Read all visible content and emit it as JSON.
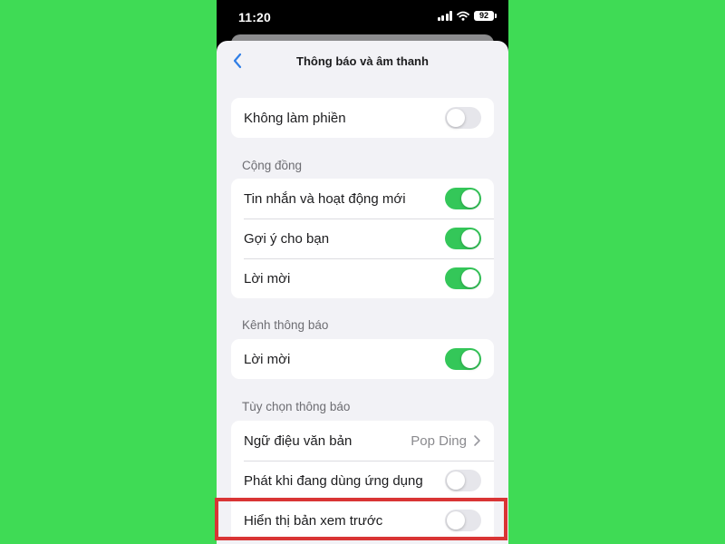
{
  "status_bar": {
    "time": "11:20",
    "battery": "92",
    "icons": [
      "signal-icon",
      "wifi-icon",
      "battery-icon"
    ]
  },
  "nav": {
    "title": "Thông báo và âm thanh",
    "back_icon": "chevron-left-icon"
  },
  "dnd": {
    "label": "Không làm phiền",
    "enabled": false
  },
  "community": {
    "header": "Cộng đồng",
    "items": [
      {
        "label": "Tin nhắn và hoạt động mới",
        "enabled": true
      },
      {
        "label": "Gợi ý cho bạn",
        "enabled": true
      },
      {
        "label": "Lời mời",
        "enabled": true
      }
    ]
  },
  "channel": {
    "header": "Kênh thông báo",
    "items": [
      {
        "label": "Lời mời",
        "enabled": true
      }
    ]
  },
  "options": {
    "header": "Tùy chọn thông báo",
    "tone": {
      "label": "Ngữ điệu văn bản",
      "value": "Pop Ding"
    },
    "in_app": {
      "label": "Phát khi đang dùng ứng dụng",
      "enabled": false
    },
    "preview": {
      "label": "Hiển thị bản xem trước",
      "enabled": false
    }
  },
  "colors": {
    "background": "#3fdb55",
    "toggle_on": "#34c759",
    "toggle_off": "#e6e6eb",
    "accent": "#2f7ee6",
    "highlight": "#d93535"
  }
}
